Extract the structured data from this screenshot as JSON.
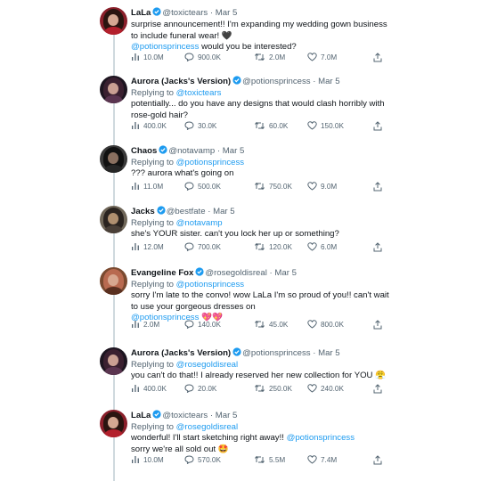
{
  "tweets": [
    {
      "name": "LaLa",
      "handle": "@toxictears",
      "date": "Mar 5",
      "replying": [],
      "text": [
        {
          "t": "surprise announcement!! I'm expanding my wedding gown business to include funeral wear! 🖤",
          "m": false
        },
        {
          "t": "\n",
          "m": false
        },
        {
          "t": "@potionsprincess",
          "m": true
        },
        {
          "t": " would you be interested?",
          "m": false
        }
      ],
      "metrics": {
        "views": "10.0M",
        "replies": "900.0K",
        "retweets": "2.0M",
        "likes": "7.0M"
      }
    },
    {
      "name": "Aurora (Jacks's Version)",
      "handle": "@potionsprincess",
      "date": "Mar 5",
      "replying": [
        "@toxictears"
      ],
      "text": [
        {
          "t": "potentially... do you have any designs that would clash horribly with rose-gold hair?",
          "m": false
        }
      ],
      "metrics": {
        "views": "400.0K",
        "replies": "30.0K",
        "retweets": "60.0K",
        "likes": "150.0K"
      }
    },
    {
      "name": "Chaos",
      "handle": "@notavamp",
      "date": "Mar 5",
      "replying": [
        "@potionsprincess"
      ],
      "text": [
        {
          "t": "??? aurora what's going on",
          "m": false
        }
      ],
      "metrics": {
        "views": "11.0M",
        "replies": "500.0K",
        "retweets": "750.0K",
        "likes": "9.0M"
      }
    },
    {
      "name": "Jacks",
      "handle": "@bestfate",
      "date": "Mar 5",
      "replying": [
        "@notavamp"
      ],
      "text": [
        {
          "t": "she's YOUR sister. can't you lock her up or something?",
          "m": false
        }
      ],
      "metrics": {
        "views": "12.0M",
        "replies": "700.0K",
        "retweets": "120.0K",
        "likes": "6.0M"
      }
    },
    {
      "name": "Evangeline Fox",
      "handle": "@rosegoldisreal",
      "date": "Mar 5",
      "replying": [
        "@potionsprincess"
      ],
      "text": [
        {
          "t": "sorry I'm late to the convo! wow LaLa I'm so proud of you!! can't wait to use your gorgeous dresses on",
          "m": false
        },
        {
          "t": "\n",
          "m": false
        },
        {
          "t": "@potionsprincess",
          "m": true
        },
        {
          "t": " 💖💖",
          "m": false
        }
      ],
      "metrics": {
        "views": "2.0M",
        "replies": "140.0K",
        "retweets": "45.0K",
        "likes": "800.0K"
      }
    },
    {
      "name": "Aurora (Jacks's Version)",
      "handle": "@potionsprincess",
      "date": "Mar 5",
      "replying": [
        "@rosegoldisreal"
      ],
      "text": [
        {
          "t": "you can't do that!! I already reserved her new collection for YOU 😤",
          "m": false
        }
      ],
      "metrics": {
        "views": "400.0K",
        "replies": "20.0K",
        "retweets": "250.0K",
        "likes": "240.0K"
      }
    },
    {
      "name": "LaLa",
      "handle": "@toxictears",
      "date": "Mar 5",
      "replying": [
        "@rosegoldisreal"
      ],
      "text": [
        {
          "t": "wonderful! I'll start sketching right away!! ",
          "m": false
        },
        {
          "t": "@potionsprincess",
          "m": true
        },
        {
          "t": "\n sorry we're all sold out 🤩",
          "m": false
        }
      ],
      "metrics": {
        "views": "10.0M",
        "replies": "570.0K",
        "retweets": "5.5M",
        "likes": "7.4M"
      }
    }
  ],
  "labels": {
    "replying_prefix": "Replying to ",
    "dot": "·"
  },
  "icons": {
    "views": "views-icon",
    "reply": "reply-icon",
    "retweet": "retweet-icon",
    "like": "heart-icon",
    "share": "share-icon",
    "verified": "verified-badge-icon"
  },
  "colors": {
    "mention": "#1d9bf0",
    "verified": "#1d9bf0",
    "secondary_text": "#536471",
    "thread_line": "#cfd9de"
  }
}
